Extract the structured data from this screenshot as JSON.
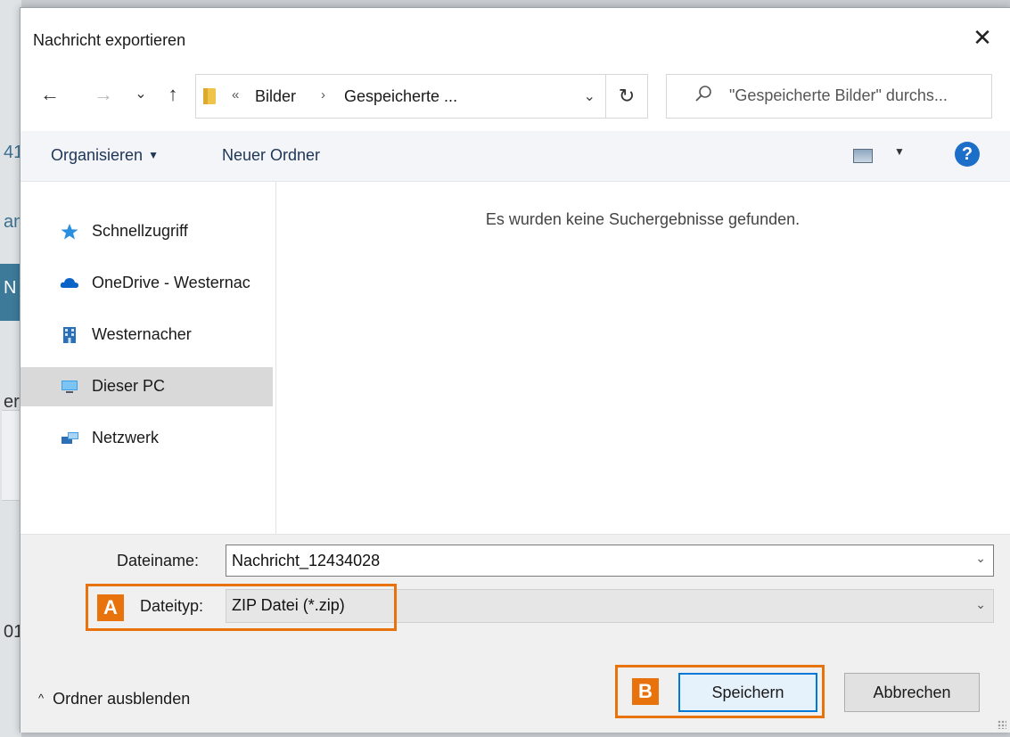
{
  "background": {
    "fragments": [
      "41",
      "an",
      "N",
      "er",
      "01"
    ]
  },
  "dialog": {
    "title": "Nachricht exportieren",
    "close_glyph": "✕"
  },
  "nav": {
    "back": "←",
    "forward": "→",
    "recent": "⌄",
    "up": "↑",
    "breadcrumb_prefix": "«",
    "breadcrumbs": [
      "Bilder",
      "Gespeicherte ..."
    ],
    "breadcrumb_sep": "›",
    "address_dropdown": "⌄",
    "refresh": "↻"
  },
  "search": {
    "placeholder": "\"Gespeicherte Bilder\" durchs..."
  },
  "toolbar": {
    "organize_label": "Organisieren",
    "organize_caret": "▼",
    "new_folder_label": "Neuer Ordner",
    "view_caret": "▼",
    "help_label": "?"
  },
  "sidebar": {
    "items": [
      {
        "label": "Schnellzugriff",
        "icon": "star-icon"
      },
      {
        "label": "OneDrive - Westernac",
        "icon": "cloud-icon"
      },
      {
        "label": "Westernacher",
        "icon": "building-icon"
      },
      {
        "label": "Dieser PC",
        "icon": "computer-icon",
        "selected": true
      },
      {
        "label": "Netzwerk",
        "icon": "network-icon"
      }
    ]
  },
  "content": {
    "empty_message": "Es wurden keine Suchergebnisse gefunden."
  },
  "form": {
    "filename_label": "Dateiname:",
    "filename_value": "Nachricht_12434028",
    "filetype_label": "Dateityp:",
    "filetype_value": "ZIP Datei (*.zip)",
    "dropdown_glyph": "⌄"
  },
  "annotations": {
    "callout_a": "A",
    "callout_b": "B",
    "accent_color": "#e8720c"
  },
  "footer": {
    "hide_folders_glyph": "^",
    "hide_folders_label": "Ordner ausblenden",
    "save_label": "Speichern",
    "cancel_label": "Abbrechen"
  }
}
